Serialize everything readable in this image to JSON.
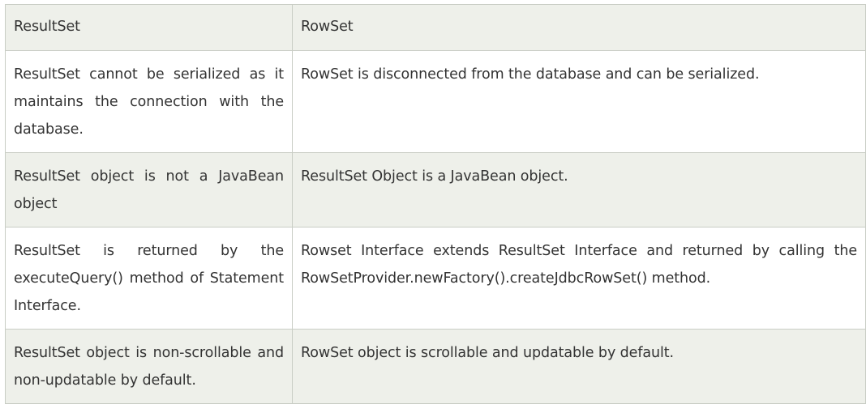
{
  "table": {
    "headers": [
      "ResultSet",
      "RowSet"
    ],
    "rows": [
      {
        "resultset": "ResultSet cannot be serialized as it maintains the connection with the database.",
        "rowset": "RowSet is disconnected from the database and can be serialized."
      },
      {
        "resultset": "ResultSet object is not a JavaBean object",
        "rowset": "ResultSet Object is a JavaBean object."
      },
      {
        "resultset": "ResultSet is returned by the executeQuery() method of Statement Interface.",
        "rowset": "Rowset Interface extends ResultSet Interface and returned by calling the RowSetProvider.newFactory().createJdbcRowSet() method."
      },
      {
        "resultset": "ResultSet object is non-scrollable and non-updatable by default.",
        "rowset": "RowSet object is scrollable and updatable by default."
      }
    ]
  },
  "colors": {
    "shaded_row": "#eef0ea",
    "plain_row": "#ffffff",
    "border": "#c9cdc5",
    "text": "#333333"
  }
}
